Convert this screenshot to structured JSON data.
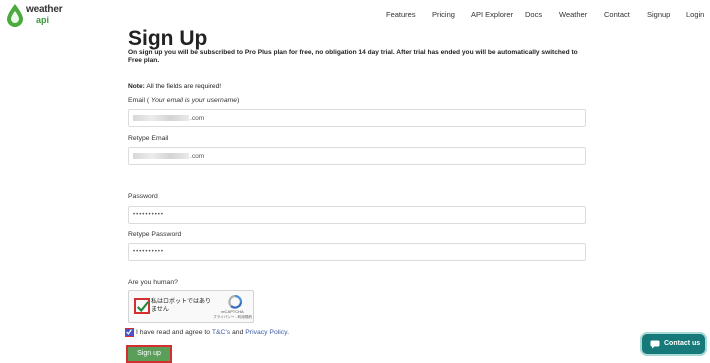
{
  "header": {
    "brand_top": "weather",
    "brand_bottom": "api",
    "nav": [
      "Features",
      "Pricing",
      "API Explorer",
      "Docs",
      "Weather",
      "Contact",
      "Signup",
      "Login"
    ]
  },
  "page": {
    "title": "Sign Up",
    "intro": "On sign up you will be subscribed to Pro Plus plan for free, no obligation 14 day trial. After trial has ended you will be automatically switched to Free plan.",
    "note_label": "Note:",
    "note_text": " All the fields are required!"
  },
  "form": {
    "email_label": "Email (",
    "email_hint": " Your email is your username",
    "email_label_end": ")",
    "email_value_suffix": ".com",
    "retype_email_label": "Retype Email",
    "retype_email_value_suffix": ".com",
    "password_label": "Password",
    "password_value": "••••••••••",
    "retype_password_label": "Retype Password",
    "retype_password_value": "••••••••••",
    "human_label": "Are you human?",
    "captcha_text": "私はロボットではありません",
    "captcha_brand": "reCAPTCHA",
    "captcha_terms": "プライバシー - 利用規約",
    "agree_prefix": "I have read and agree to ",
    "agree_tc": "T&C's",
    "agree_and": " and ",
    "agree_privacy": "Privacy Policy",
    "agree_end": ".",
    "submit_label": "Sign up"
  },
  "contact": {
    "label": "Contact us"
  },
  "colors": {
    "accent_green": "#5a9e5a",
    "highlight_red": "#d32f2f",
    "contact_teal": "#17797a",
    "link_blue": "#3b5ba5"
  }
}
